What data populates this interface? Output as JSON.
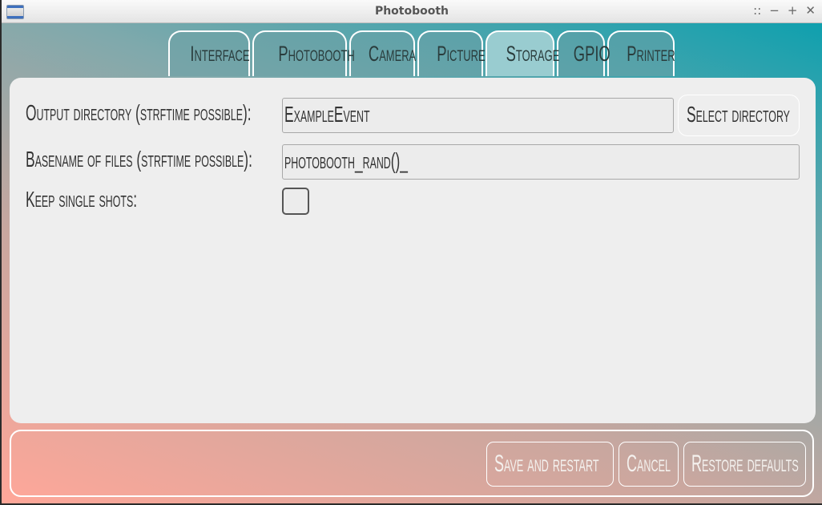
{
  "window": {
    "title": "Photobooth",
    "controls": {
      "menu": "::",
      "minimize": "−",
      "maximize": "+",
      "close": "✕"
    }
  },
  "tabs": [
    {
      "label": "Interface",
      "active": false
    },
    {
      "label": "Photobooth",
      "active": false
    },
    {
      "label": "Camera",
      "active": false
    },
    {
      "label": "Picture",
      "active": false
    },
    {
      "label": "Storage",
      "active": true
    },
    {
      "label": "GPIO",
      "active": false
    },
    {
      "label": "Printer",
      "active": false
    }
  ],
  "storage": {
    "output_dir_label": "Output directory (strftime possible):",
    "output_dir_value": "ExampleEvent",
    "select_dir_label": "Select directory",
    "basename_label": "Basename of files (strftime possible):",
    "basename_value": "photobooth_rand()_",
    "keep_single_label": "Keep single shots:",
    "keep_single_checked": false
  },
  "actions": {
    "save": "Save and restart",
    "cancel": "Cancel",
    "restore": "Restore defaults"
  },
  "colors": {
    "gradient_top_right": "#0fa0ae",
    "gradient_bottom_left": "#ffa799",
    "panel": "#eeeeee",
    "active_tab": "#99ccd0"
  }
}
